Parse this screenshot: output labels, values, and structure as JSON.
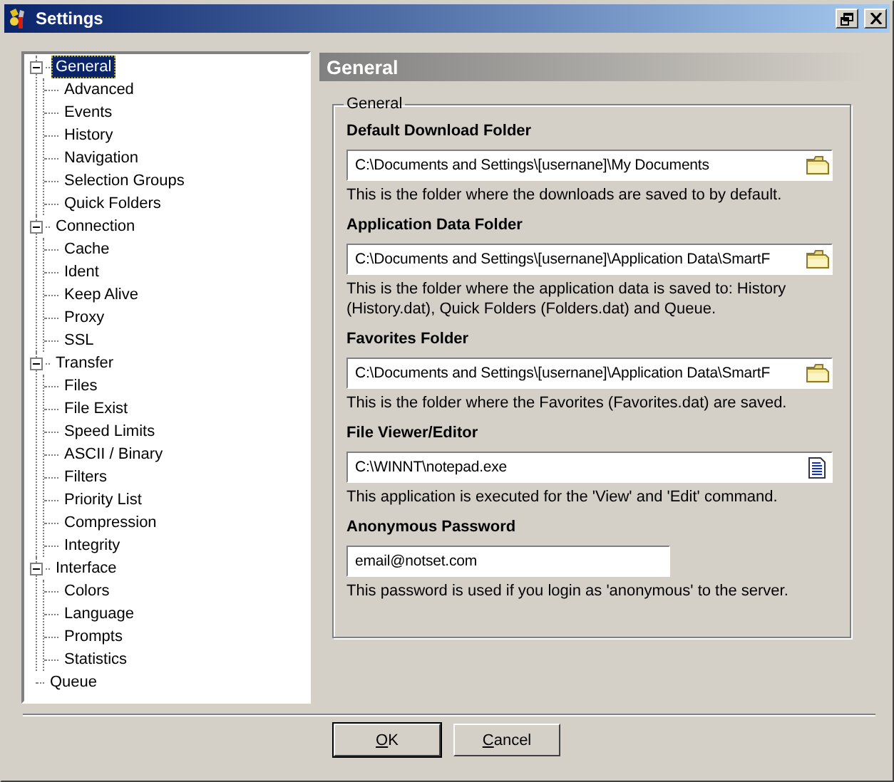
{
  "window": {
    "title": "Settings"
  },
  "tree": [
    {
      "label": "General",
      "selected": true,
      "expanded": true,
      "children": [
        {
          "label": "Advanced",
          "selected": false
        },
        {
          "label": "Events",
          "selected": false
        },
        {
          "label": "History",
          "selected": false
        },
        {
          "label": "Navigation",
          "selected": false
        },
        {
          "label": "Selection Groups",
          "selected": false
        },
        {
          "label": "Quick Folders",
          "selected": false
        }
      ]
    },
    {
      "label": "Connection",
      "selected": false,
      "expanded": true,
      "children": [
        {
          "label": "Cache",
          "selected": false
        },
        {
          "label": "Ident",
          "selected": false
        },
        {
          "label": "Keep Alive",
          "selected": false
        },
        {
          "label": "Proxy",
          "selected": false
        },
        {
          "label": "SSL",
          "selected": false
        }
      ]
    },
    {
      "label": "Transfer",
      "selected": false,
      "expanded": true,
      "children": [
        {
          "label": "Files",
          "selected": false
        },
        {
          "label": "File Exist",
          "selected": false
        },
        {
          "label": "Speed Limits",
          "selected": false
        },
        {
          "label": "ASCII / Binary",
          "selected": false
        },
        {
          "label": "Filters",
          "selected": false
        },
        {
          "label": "Priority List",
          "selected": false
        },
        {
          "label": "Compression",
          "selected": false
        },
        {
          "label": "Integrity",
          "selected": false
        }
      ]
    },
    {
      "label": "Interface",
      "selected": false,
      "expanded": true,
      "children": [
        {
          "label": "Colors",
          "selected": false
        },
        {
          "label": "Language",
          "selected": false
        },
        {
          "label": "Prompts",
          "selected": false
        },
        {
          "label": "Statistics",
          "selected": false
        }
      ]
    },
    {
      "label": "Queue",
      "selected": false
    }
  ],
  "page": {
    "title": "General",
    "group": "General",
    "settings": [
      {
        "label": "Default Download Folder",
        "kind": "folder",
        "value": "C:\\Documents and Settings\\[usernane]\\My Documents",
        "help": "This is the folder where the downloads are saved to by default."
      },
      {
        "label": "Application Data Folder",
        "kind": "folder",
        "value": "C:\\Documents and Settings\\[usernane]\\Application Data\\SmartF",
        "help": "This is the folder where the application data is saved to: History (History.dat), Quick Folders (Folders.dat) and Queue."
      },
      {
        "label": "Favorites Folder",
        "kind": "folder",
        "value": "C:\\Documents and Settings\\[usernane]\\Application Data\\SmartF",
        "help": "This is the folder where the Favorites (Favorites.dat) are saved."
      },
      {
        "label": "File Viewer/Editor",
        "kind": "file",
        "value": "C:\\WINNT\\notepad.exe",
        "help": "This application is executed for the 'View' and 'Edit' command."
      },
      {
        "label": "Anonymous Password",
        "kind": "text",
        "value": "email@notset.com",
        "help": "This password is used if you login as 'anonymous' to the server."
      }
    ]
  },
  "buttons": [
    {
      "label": "OK",
      "first_letter_underlined": true,
      "default": true
    },
    {
      "label": "Cancel",
      "first_letter_underlined": true,
      "default": false
    }
  ]
}
